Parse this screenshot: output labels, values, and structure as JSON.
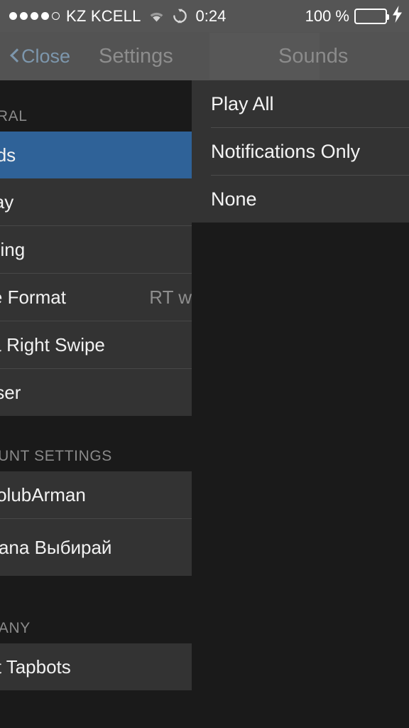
{
  "status_bar": {
    "signal_dots_filled": 4,
    "signal_dots_total": 5,
    "carrier": "KZ KCELL",
    "wifi_icon": "wifi-icon",
    "sync_icon": "sync-icon",
    "time": "0:24",
    "battery_percent": "100 %",
    "battery_charging": true,
    "battery_color": "#4ed45f"
  },
  "nav_bar": {
    "close_label": "Close",
    "back_icon": "chevron-left-icon",
    "title": "Settings",
    "right_title": "Sounds",
    "tint_color": "#7d97ad"
  },
  "settings_panel": {
    "accent_color": "#2f6298",
    "sections": [
      {
        "header": "GENERAL",
        "rows": [
          {
            "label": "Sounds",
            "value": "",
            "selected": true
          },
          {
            "label": "Display",
            "value": "",
            "selected": false
          },
          {
            "label": "Theming",
            "value": "",
            "selected": false
          },
          {
            "label": "Name Format",
            "value": "RT w",
            "selected": false
          },
          {
            "label": "Left & Right Swipe",
            "value": "",
            "selected": false
          },
          {
            "label": "Browser",
            "value": "",
            "selected": false
          }
        ]
      },
      {
        "header": "ACCOUNT SETTINGS",
        "rows": [
          {
            "label": "@avtolubArman",
            "value": "",
            "selected": false
          },
          {
            "label": "@Astana Выбирай",
            "value": "",
            "selected": false
          }
        ]
      },
      {
        "header": "COMPANY",
        "rows": [
          {
            "label": "About Tapbots",
            "value": "",
            "selected": false
          }
        ]
      }
    ]
  },
  "sounds_panel": {
    "options": [
      {
        "label": "Play All"
      },
      {
        "label": "Notifications Only"
      },
      {
        "label": "None"
      }
    ]
  }
}
